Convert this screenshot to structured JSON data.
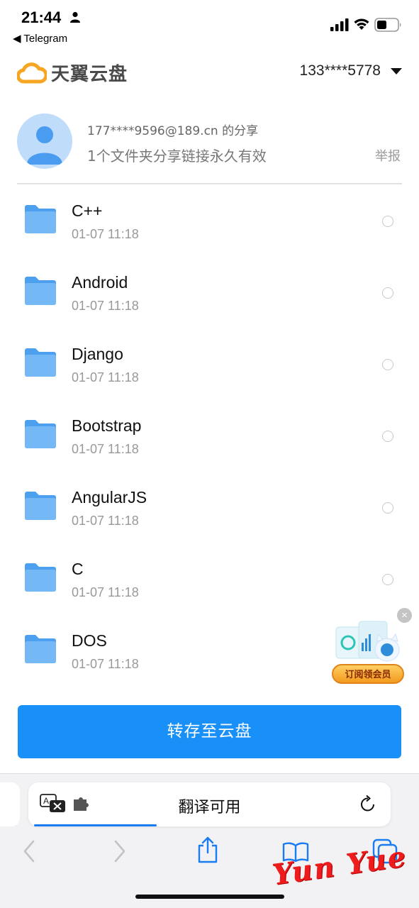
{
  "status_bar": {
    "time": "21:44",
    "back_app": "◀ Telegram"
  },
  "header": {
    "logo_text": "天翼云盘",
    "account": "133****5778"
  },
  "sharer": {
    "email_line": "177****9596@189.cn 的分享",
    "description": "1个文件夹分享链接永久有效",
    "report_label": "举报"
  },
  "files": [
    {
      "name": "C++",
      "date": "01-07 11:18"
    },
    {
      "name": "Android",
      "date": "01-07 11:18"
    },
    {
      "name": "Django",
      "date": "01-07 11:18"
    },
    {
      "name": "Bootstrap",
      "date": "01-07 11:18"
    },
    {
      "name": "AngularJS",
      "date": "01-07 11:18"
    },
    {
      "name": "C",
      "date": "01-07 11:18"
    },
    {
      "name": "DOS",
      "date": "01-07 11:18"
    }
  ],
  "promo": {
    "label": "订阅领会员",
    "close": "×"
  },
  "actions": {
    "save_label": "转存至云盘"
  },
  "browser": {
    "address_text": "翻译可用",
    "load_progress": 0.35
  },
  "watermark": "Yun  Yue",
  "colors": {
    "accent": "#1890f7",
    "folder": "#5aa9f2",
    "watermark": "#ee1c1c"
  }
}
